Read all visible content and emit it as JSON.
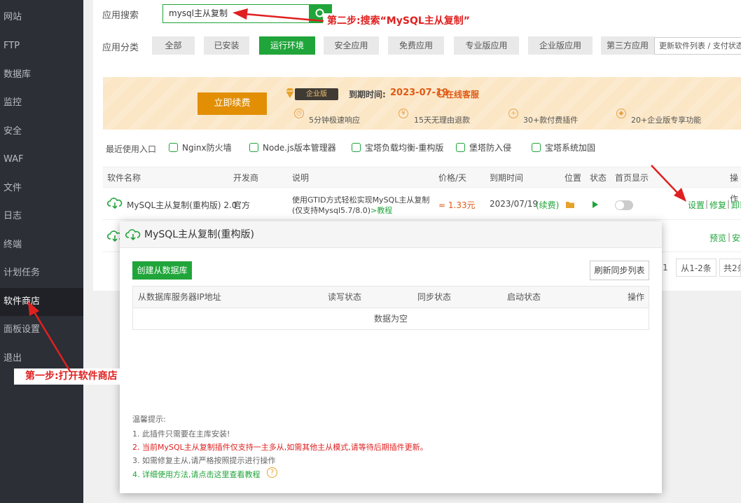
{
  "sidebar": {
    "items": [
      {
        "label": "网站"
      },
      {
        "label": "FTP"
      },
      {
        "label": "数据库"
      },
      {
        "label": "监控"
      },
      {
        "label": "安全"
      },
      {
        "label": "WAF"
      },
      {
        "label": "文件"
      },
      {
        "label": "日志"
      },
      {
        "label": "终端"
      },
      {
        "label": "计划任务"
      },
      {
        "label": "软件商店"
      },
      {
        "label": "面板设置"
      },
      {
        "label": "退出"
      }
    ],
    "active": "软件商店"
  },
  "search": {
    "label": "应用搜索",
    "value": "mysql主从复制"
  },
  "categories": {
    "label": "应用分类",
    "items": [
      "全部",
      "已安装",
      "运行环境",
      "安全应用",
      "免费应用",
      "专业版应用",
      "企业版应用",
      "第三方应用"
    ],
    "active": "运行环境",
    "refresh_dropdown": "更新软件列表 / 支付状态"
  },
  "banner": {
    "renew_button": "立即续费",
    "edition_tag": "企业版",
    "expire_label": "到期时间:",
    "expire_date": "2023-07-19",
    "support_link": "在线客服",
    "features": [
      "5分钟极速响应",
      "15天无理由退款",
      "30+款付费插件",
      "20+企业版专享功能"
    ]
  },
  "recent": {
    "label": "最近使用入口",
    "items": [
      "Nginx防火墙",
      "Node.js版本管理器",
      "宝塔负载均衡-重构版",
      "堡塔防入侵",
      "宝塔系统加固"
    ]
  },
  "table": {
    "headers": [
      "软件名称",
      "开发商",
      "说明",
      "价格/天",
      "到期时间",
      "位置",
      "状态",
      "首页显示",
      "操作"
    ],
    "rows": [
      {
        "name": "MySQL主从复制(重构版) 2.0",
        "vendor": "官方",
        "desc_line1": "使用GTID方式轻松实现MySQL主从复制",
        "desc_line2": "(仅支持Mysql5.7/8.0)",
        "desc_link": ">教程",
        "price": "≈ 1.33元",
        "expire": "2023/07/19",
        "renew": "(续费)",
        "actions": [
          "设置",
          "修复",
          "卸载"
        ]
      }
    ],
    "row2_actions": [
      "预览",
      "安装"
    ]
  },
  "pager": {
    "page": "1",
    "range": "从1-2条",
    "total": "共2条"
  },
  "modal": {
    "title": "MySQL主从复制(重构版)",
    "create_button": "创建从数据库",
    "refresh_button": "刷新同步列表",
    "headers": [
      "从数据库服务器IP地址",
      "读写状态",
      "同步状态",
      "启动状态",
      "操作"
    ],
    "empty": "数据为空",
    "tips_title": "温馨提示:",
    "tips": [
      "1. 此插件只需要在主库安装!",
      "2. 当前MySQL主从复制插件仅支持一主多从,如需其他主从模式,请等待后期插件更新。",
      "3. 如需修复主从,请严格按照提示进行操作",
      "4. 详细使用方法,请点击这里查看教程"
    ]
  },
  "annotations": {
    "step1": "第一步:打开软件商店",
    "step2": "第二步:搜索“MySQL主从复制”"
  },
  "colors": {
    "accent": "#20a53a",
    "sidebar": "#2c2f35",
    "renew": "#e28f05",
    "annotation": "#e02020"
  }
}
